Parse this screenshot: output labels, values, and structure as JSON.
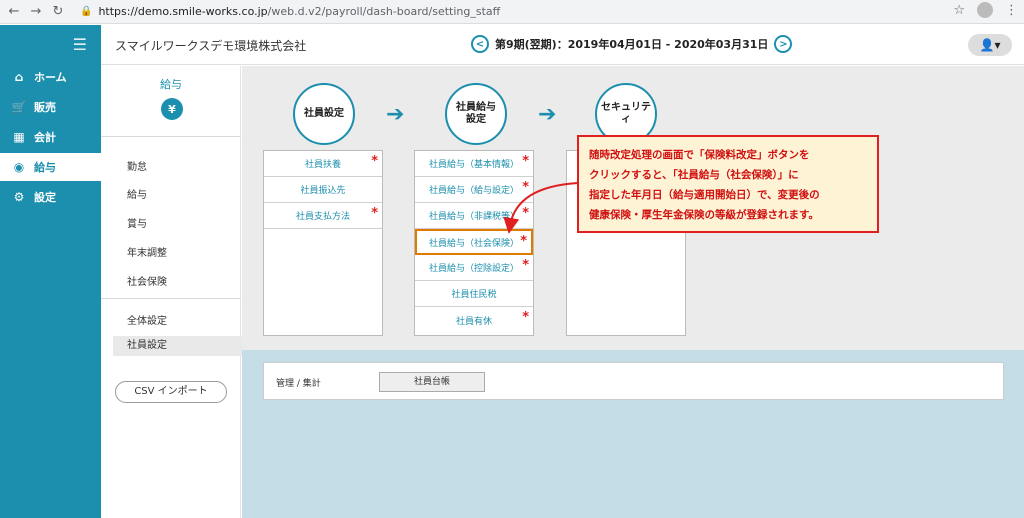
{
  "browser": {
    "url_host": "https://demo.smile-works.co.jp",
    "url_path": "/web.d.v2/payroll/dash-board/setting_staff"
  },
  "sidebar": {
    "items": [
      {
        "icon": "home-icon",
        "glyph": "⌂",
        "label": "ホーム"
      },
      {
        "icon": "cart-icon",
        "glyph": "🛒",
        "label": "販売"
      },
      {
        "icon": "calculator-icon",
        "glyph": "▦",
        "label": "会計"
      },
      {
        "icon": "money-bag-icon",
        "glyph": "◉",
        "label": "給与"
      },
      {
        "icon": "gear-icon",
        "glyph": "⚙",
        "label": "設定"
      }
    ]
  },
  "header": {
    "company": "スマイルワークスデモ環境株式会社",
    "period": "第9期(翌期)：2019年04月01日 - 2020年03月31日",
    "prev": "<",
    "next": ">",
    "user_glyph": "👤▾"
  },
  "submenu": {
    "title": "給与",
    "yen": "¥",
    "items": [
      "勤怠",
      "給与",
      "賞与",
      "年末調整",
      "社会保険"
    ],
    "items2": [
      "全体設定",
      "社員設定"
    ],
    "csv_button": "CSV インポート"
  },
  "steps": [
    {
      "line1": "社員設定",
      "line2": ""
    },
    {
      "line1": "社員給与",
      "line2": "設定"
    },
    {
      "line1": "セキュリティ",
      "line2": ""
    }
  ],
  "arrow_glyph": "➔",
  "col1": [
    {
      "label": "社員扶養",
      "star": "*"
    },
    {
      "label": "社員振込先",
      "star": ""
    },
    {
      "label": "社員支払方法",
      "star": "*"
    }
  ],
  "col2": [
    {
      "label": "社員給与（基本情報）",
      "star": "*"
    },
    {
      "label": "社員給与（給与設定）",
      "star": "*"
    },
    {
      "label": "社員給与（非課税等）",
      "star": "*"
    },
    {
      "label": "社員給与（社会保険）",
      "star": "*"
    },
    {
      "label": "社員給与（控除設定）",
      "star": "*"
    },
    {
      "label": "社員住民税",
      "star": ""
    },
    {
      "label": "社員有休",
      "star": "*"
    }
  ],
  "management": {
    "label": "管理 / 集計",
    "button": "社員台帳"
  },
  "callout": {
    "line1": "随時改定処理の画面で「保険料改定」ボタンを",
    "line2": "クリックすると、「社員給与（社会保険）」に",
    "line3": "指定した年月日（給与適用開始日）で、変更後の",
    "line4": "健康保険・厚生年金保険の等級が登録されます。"
  },
  "colors": {
    "accent": "#1d8fae",
    "alert": "#e02020",
    "highlight": "#e07b00"
  }
}
